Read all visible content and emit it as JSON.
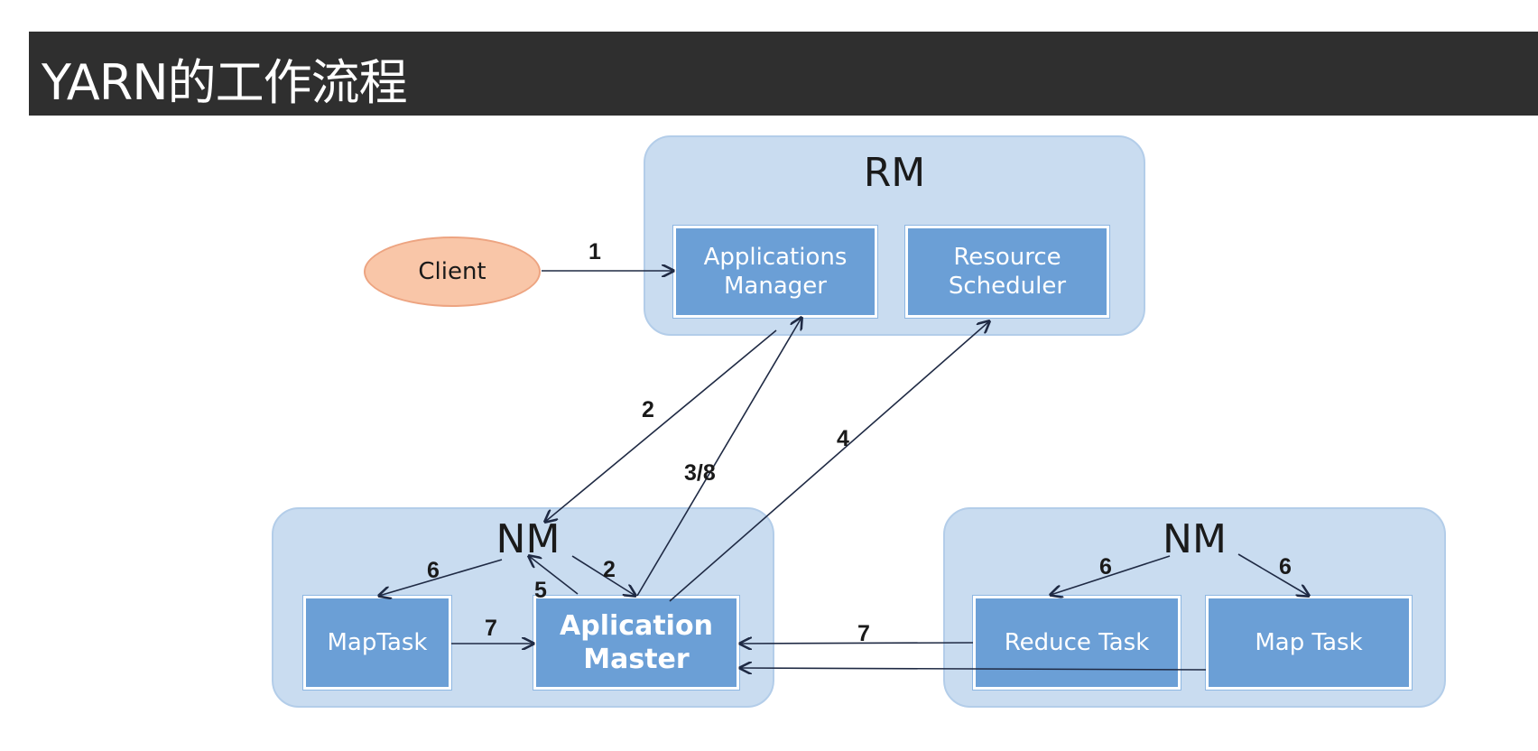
{
  "title": "YARN的工作流程",
  "rm": {
    "label": "RM",
    "applications_manager": [
      "Applications",
      "Manager"
    ],
    "resource_scheduler": [
      "Resource",
      "Scheduler"
    ]
  },
  "client": {
    "label": "Client"
  },
  "nm_left": {
    "label": "NM",
    "maptask": "MapTask",
    "application_master": [
      "Aplication",
      "Master"
    ]
  },
  "nm_right": {
    "label": "NM",
    "reduce_task": "Reduce Task",
    "map_task": "Map Task"
  },
  "edge_labels": {
    "client_to_am": "1",
    "am_to_nm": "2",
    "appmaster_to_am": "3/8",
    "appmaster_to_rs": "4",
    "nm_to_maptask": "6",
    "nm_to_appmaster": "2",
    "appmaster_to_nm": "5",
    "maptask_to_appmaster": "7",
    "right_to_appmaster": "7",
    "nm_to_reduce": "6",
    "nm_to_map": "6"
  },
  "colors": {
    "title_bar": "#2f2f2f",
    "group_fill": "#c9dcf0",
    "box_fill": "#6b9fd6",
    "client_fill": "#f9c6a8",
    "arrow": "#1f2a44"
  }
}
